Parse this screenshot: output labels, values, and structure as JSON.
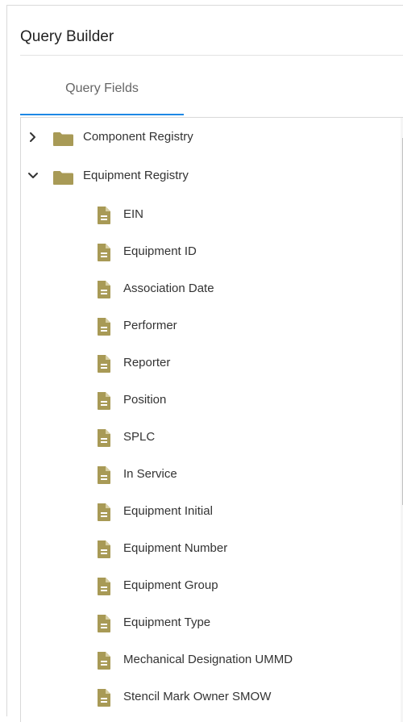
{
  "header": {
    "title": "Query Builder"
  },
  "tabs": [
    {
      "label": "Query Fields",
      "active": true
    }
  ],
  "colors": {
    "folder": "#a89a56",
    "document": "#a89a56",
    "tab_active": "#1e88e5"
  },
  "tree": {
    "folders": [
      {
        "label": "Component Registry",
        "expanded": false,
        "chevron_icon": "chevron-right-icon",
        "icon": "folder-icon"
      },
      {
        "label": "Equipment Registry",
        "expanded": true,
        "chevron_icon": "chevron-down-icon",
        "icon": "folder-icon",
        "fields": [
          {
            "label": "EIN",
            "icon": "document-icon"
          },
          {
            "label": "Equipment ID",
            "icon": "document-icon"
          },
          {
            "label": "Association Date",
            "icon": "document-icon"
          },
          {
            "label": "Performer",
            "icon": "document-icon"
          },
          {
            "label": "Reporter",
            "icon": "document-icon"
          },
          {
            "label": "Position",
            "icon": "document-icon"
          },
          {
            "label": "SPLC",
            "icon": "document-icon"
          },
          {
            "label": "In Service",
            "icon": "document-icon"
          },
          {
            "label": "Equipment Initial",
            "icon": "document-icon"
          },
          {
            "label": "Equipment Number",
            "icon": "document-icon"
          },
          {
            "label": "Equipment Group",
            "icon": "document-icon"
          },
          {
            "label": "Equipment Type",
            "icon": "document-icon"
          },
          {
            "label": "Mechanical Designation UMMD",
            "icon": "document-icon"
          },
          {
            "label": "Stencil Mark Owner SMOW",
            "icon": "document-icon"
          }
        ]
      }
    ]
  },
  "scrollbar": {
    "thumb_fraction": 0.61
  }
}
